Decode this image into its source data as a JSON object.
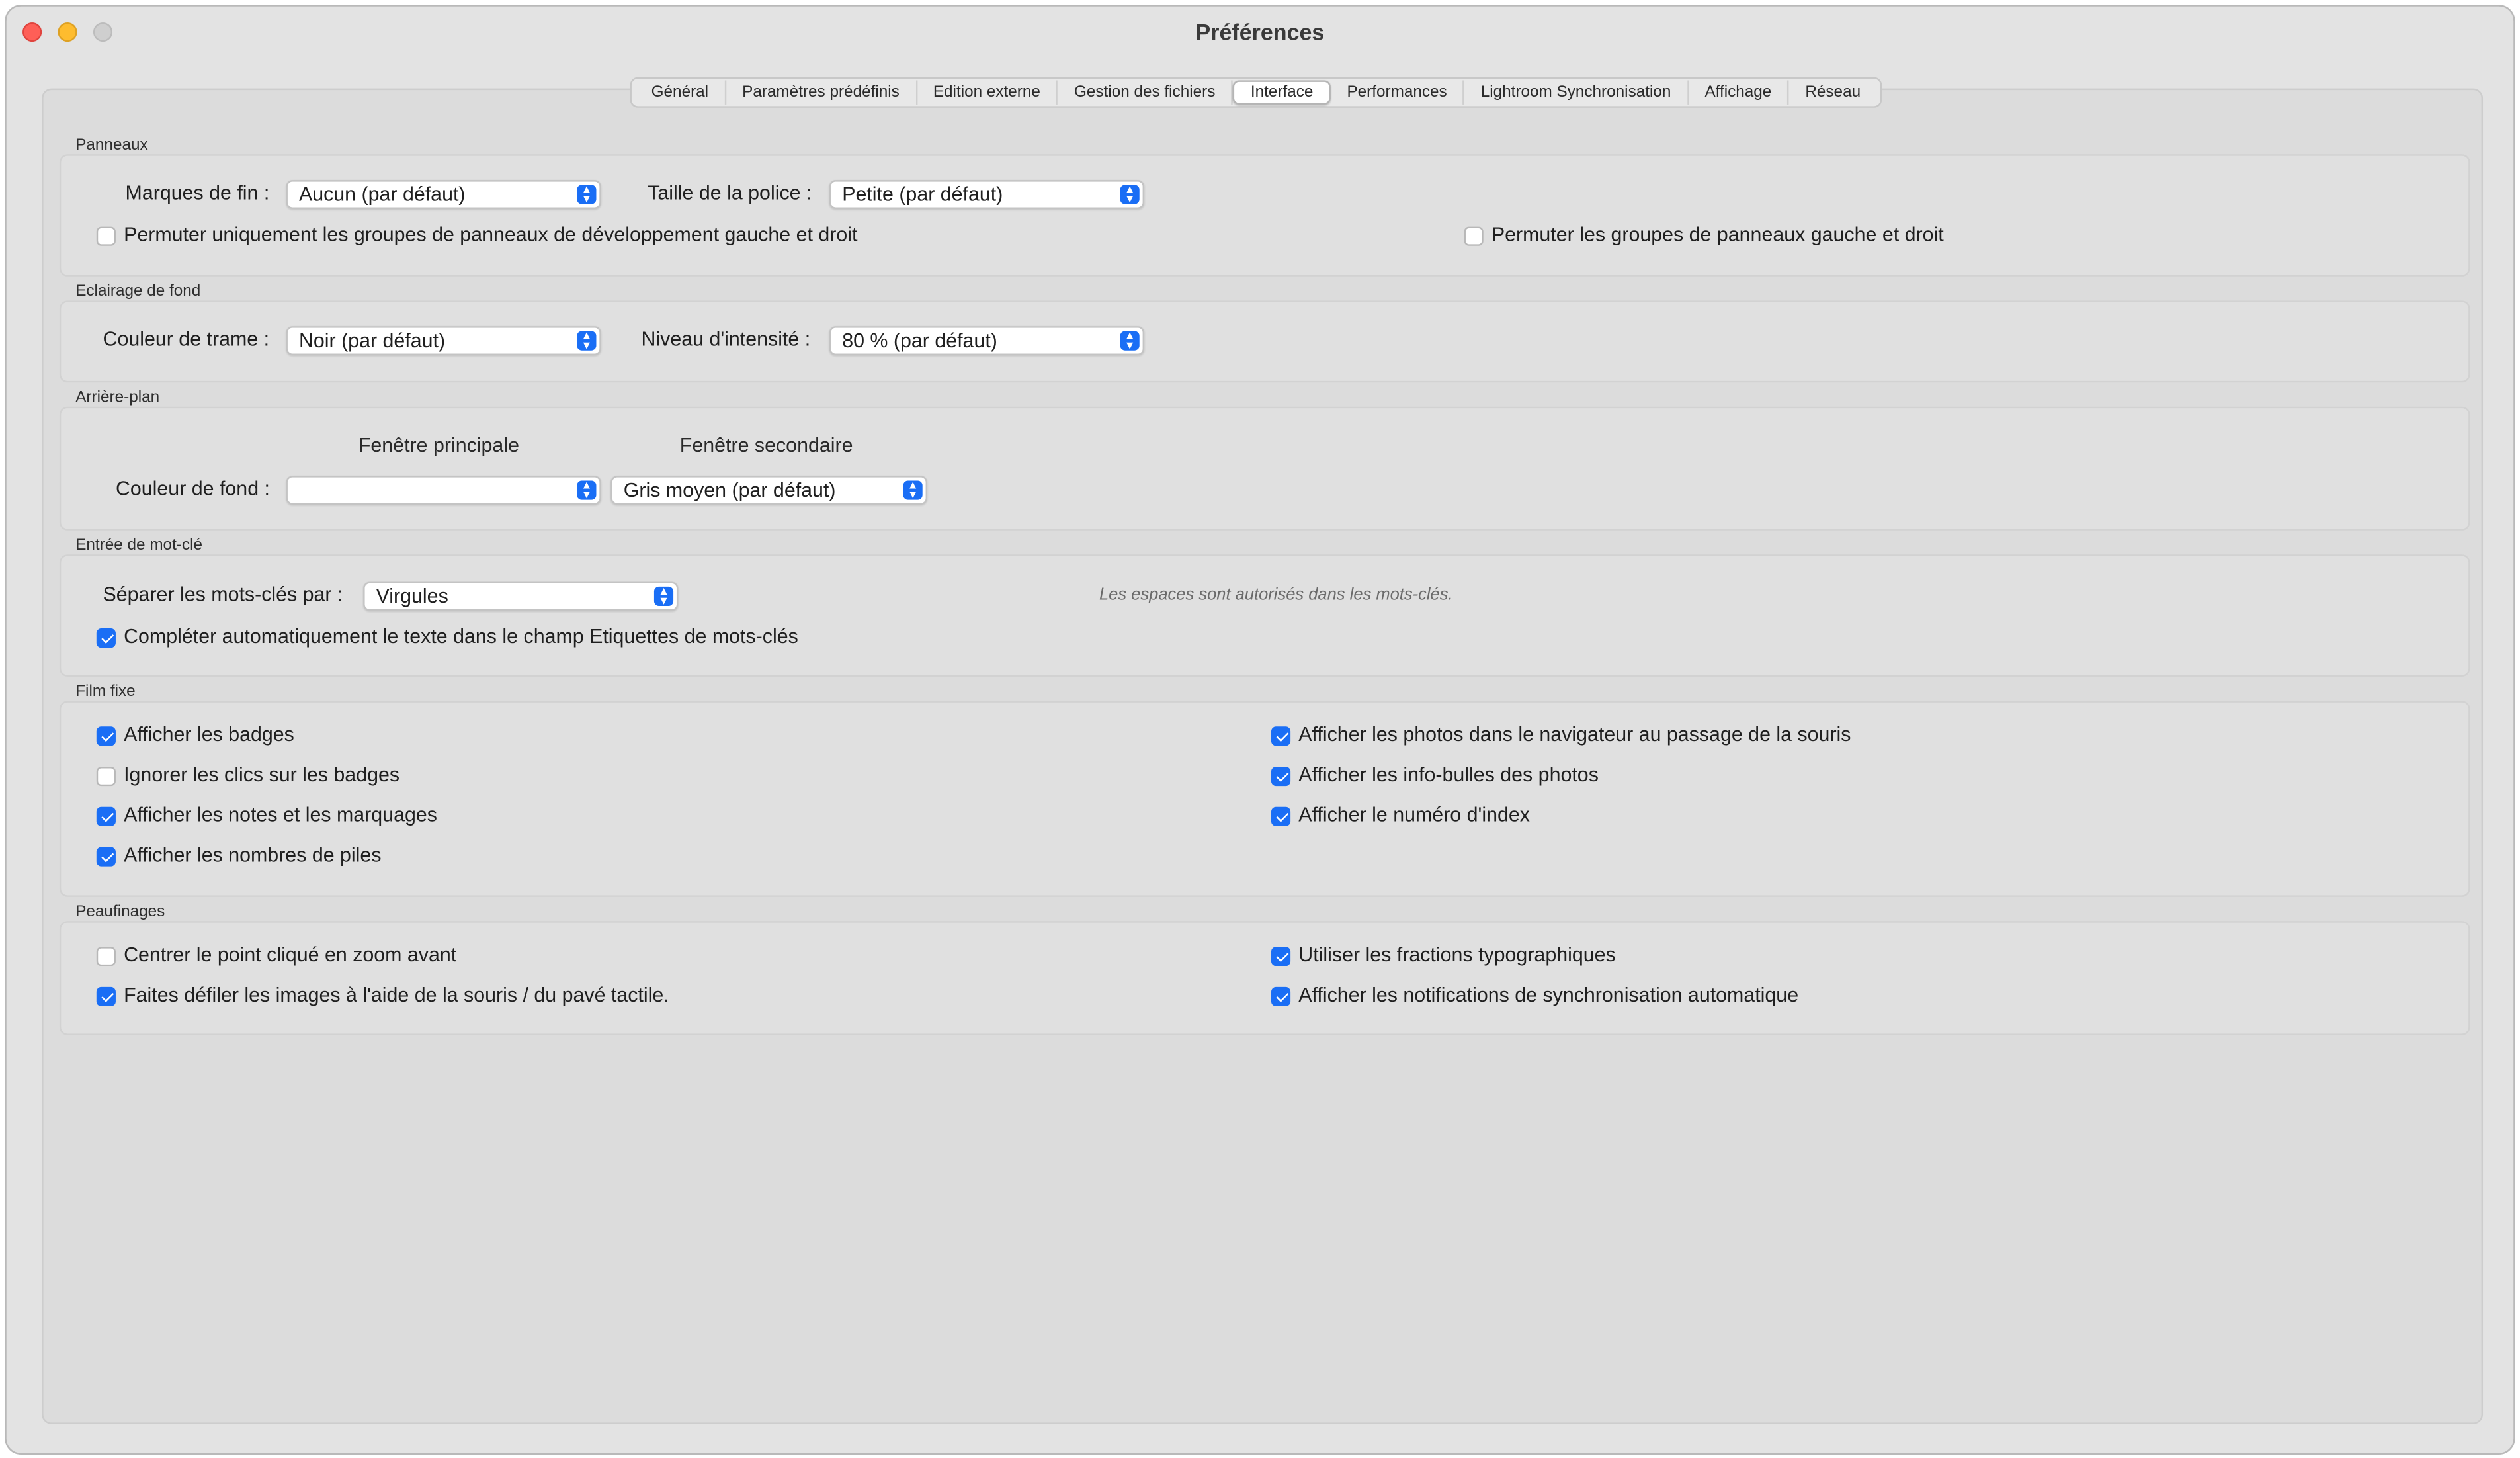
{
  "window": {
    "title": "Préférences"
  },
  "tabs": [
    {
      "label": "Général"
    },
    {
      "label": "Paramètres prédéfinis"
    },
    {
      "label": "Edition externe"
    },
    {
      "label": "Gestion des fichiers"
    },
    {
      "label": "Interface"
    },
    {
      "label": "Performances"
    },
    {
      "label": "Lightroom Synchronisation"
    },
    {
      "label": "Affichage"
    },
    {
      "label": "Réseau"
    }
  ],
  "active_tab": "Interface",
  "panneaux": {
    "title": "Panneaux",
    "marques_label": "Marques de fin :",
    "marques_value": "Aucun (par défaut)",
    "police_label": "Taille de la police :",
    "police_value": "Petite (par défaut)",
    "permuter_dev_label": "Permuter uniquement les groupes de panneaux de développement gauche et droit",
    "permuter_dev_checked": false,
    "permuter_label": "Permuter les groupes de panneaux gauche et droit",
    "permuter_checked": false
  },
  "eclairage": {
    "title": "Eclairage de fond",
    "couleur_label": "Couleur de trame :",
    "couleur_value": "Noir (par défaut)",
    "niveau_label": "Niveau d'intensité :",
    "niveau_value": "80 % (par défaut)"
  },
  "arriere_plan": {
    "title": "Arrière-plan",
    "col_principale": "Fenêtre principale",
    "col_secondaire": "Fenêtre secondaire",
    "couleur_label": "Couleur de fond :",
    "principale_value": "",
    "secondaire_value": "Gris moyen (par défaut)"
  },
  "mot_cle": {
    "title": "Entrée de mot-clé",
    "separer_label": "Séparer les mots-clés par :",
    "separer_value": "Virgules",
    "note": "Les espaces sont autorisés dans les mots-clés.",
    "completer_label": "Compléter automatiquement le texte dans le champ Etiquettes de mots-clés",
    "completer_checked": true
  },
  "film_fixe": {
    "title": "Film fixe",
    "left": [
      {
        "label": "Afficher les badges",
        "checked": true
      },
      {
        "label": "Ignorer les clics sur les badges",
        "checked": false
      },
      {
        "label": "Afficher les notes et les marquages",
        "checked": true
      },
      {
        "label": "Afficher les nombres de piles",
        "checked": true
      }
    ],
    "right": [
      {
        "label": "Afficher les photos dans le navigateur au passage de la souris",
        "checked": true
      },
      {
        "label": "Afficher les info-bulles des photos",
        "checked": true
      },
      {
        "label": "Afficher le numéro d'index",
        "checked": true
      }
    ]
  },
  "peaufinages": {
    "title": "Peaufinages",
    "left": [
      {
        "label": "Centrer le point cliqué en zoom avant",
        "checked": false
      },
      {
        "label": "Faites défiler les images à l'aide de la souris / du pavé tactile.",
        "checked": true
      }
    ],
    "right": [
      {
        "label": "Utiliser les fractions typographiques",
        "checked": true
      },
      {
        "label": "Afficher les notifications de synchronisation automatique",
        "checked": true
      }
    ]
  },
  "colors": {
    "accent": "#1a6ef5",
    "close": "#fe5f57",
    "minimize": "#febc2e"
  }
}
